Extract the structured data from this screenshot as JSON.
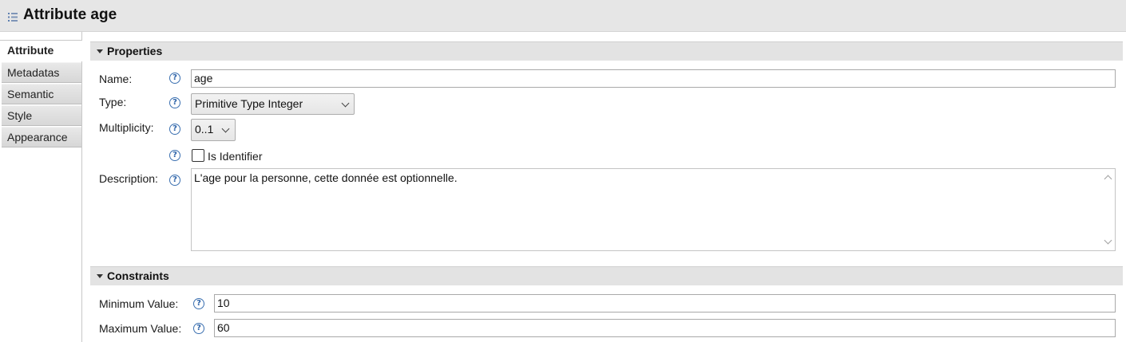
{
  "header": {
    "title": "Attribute age",
    "icon": "list-icon"
  },
  "tabs": [
    {
      "label": "Attribute",
      "active": true
    },
    {
      "label": "Metadatas",
      "active": false
    },
    {
      "label": "Semantic",
      "active": false
    },
    {
      "label": "Style",
      "active": false
    },
    {
      "label": "Appearance",
      "active": false
    }
  ],
  "properties": {
    "section_title": "Properties",
    "name_label": "Name:",
    "name_value": "age",
    "type_label": "Type:",
    "type_value": "Primitive Type Integer",
    "multiplicity_label": "Multiplicity:",
    "multiplicity_value": "0..1",
    "identifier_label": "Is Identifier",
    "identifier_checked": false,
    "description_label": "Description:",
    "description_value": "L'age pour la personne, cette donnée est optionnelle."
  },
  "constraints": {
    "section_title": "Constraints",
    "min_label": "Minimum Value:",
    "min_value": "10",
    "max_label": "Maximum Value:",
    "max_value": "60"
  },
  "help_glyph": "?",
  "colors": {
    "help_blue": "#2d63a8",
    "section_bg": "#e3e3e3",
    "title_bar_bg": "#e6e6e6"
  }
}
